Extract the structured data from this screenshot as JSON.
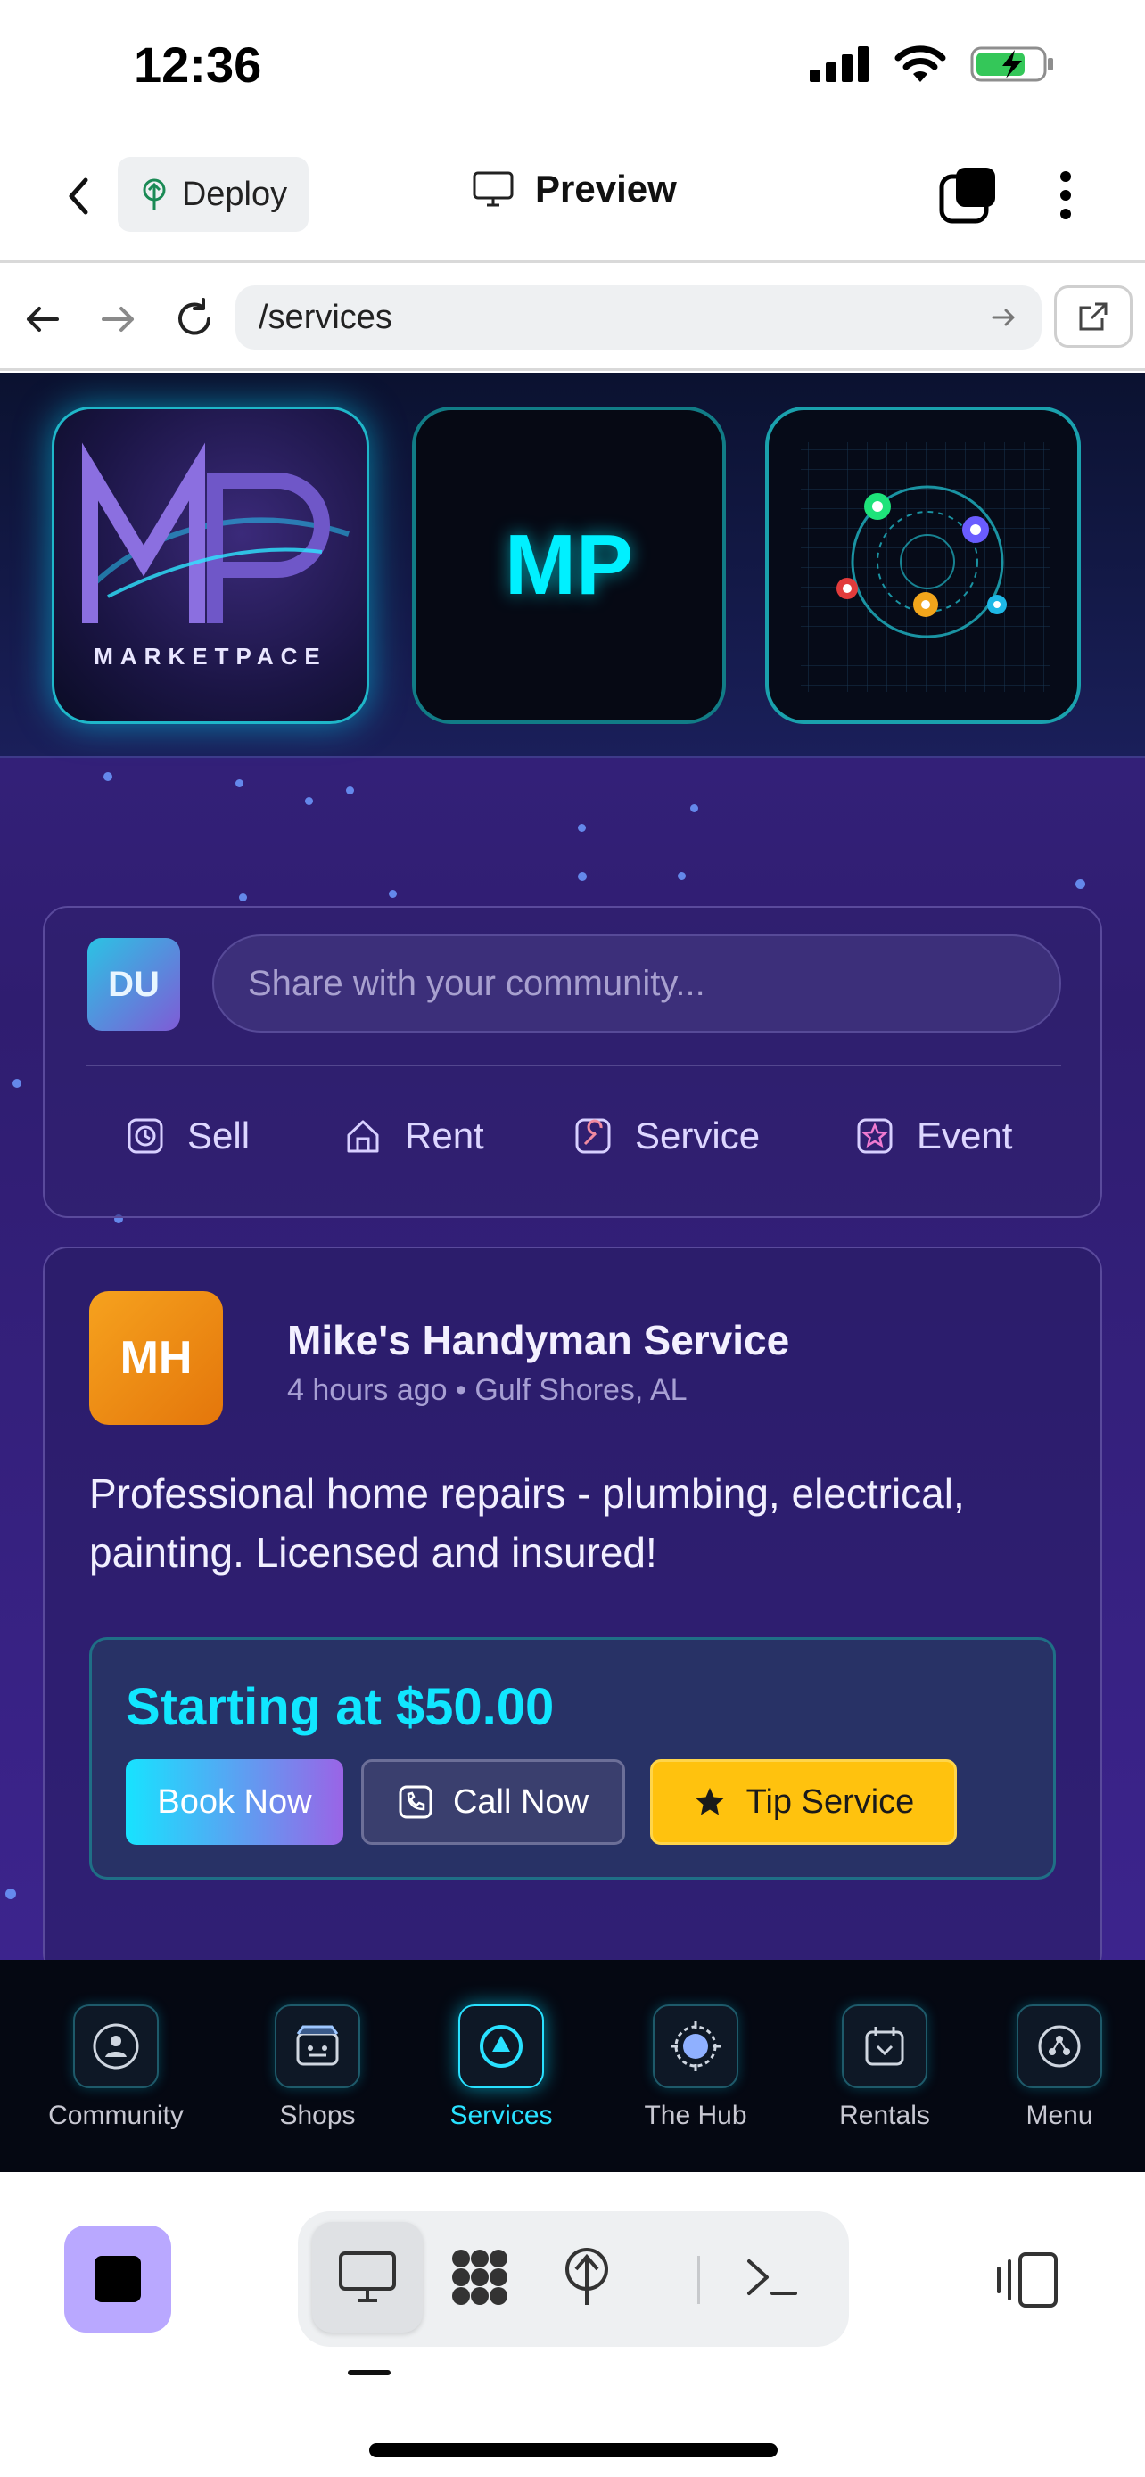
{
  "status_bar": {
    "time": "12:36"
  },
  "toolbar": {
    "deploy_label": "Deploy",
    "preview_label": "Preview"
  },
  "url_bar": {
    "url": "/services"
  },
  "logos": {
    "tile1_text": "MARKETPACE",
    "tile2_text": "MP"
  },
  "composer": {
    "avatar_initials": "DU",
    "placeholder": "Share with your community...",
    "actions": [
      {
        "label": "Sell",
        "icon": "clock-icon"
      },
      {
        "label": "Rent",
        "icon": "house-icon"
      },
      {
        "label": "Service",
        "icon": "wrench-icon"
      },
      {
        "label": "Event",
        "icon": "star-icon"
      }
    ]
  },
  "post": {
    "avatar_initials": "MH",
    "name": "Mike's Handyman Service",
    "time": "4 hours ago",
    "location": "Gulf Shores, AL",
    "body": "Professional home repairs - plumbing, electrical, painting. Licensed and insured!",
    "price": "Starting at $50.00",
    "buttons": {
      "book": "Book Now",
      "call": "Call Now",
      "tip": "Tip Service"
    }
  },
  "app_nav": [
    {
      "label": "Community",
      "icon": "community-icon",
      "active": false
    },
    {
      "label": "Shops",
      "icon": "shop-icon",
      "active": false
    },
    {
      "label": "Services",
      "icon": "services-icon",
      "active": true
    },
    {
      "label": "The Hub",
      "icon": "hub-icon",
      "active": false
    },
    {
      "label": "Rentals",
      "icon": "rentals-icon",
      "active": false
    },
    {
      "label": "Menu",
      "icon": "menu-icon",
      "active": false
    }
  ],
  "colors": {
    "accent": "#29e1ff",
    "tip_yellow": "#ffc20e",
    "stop_purple": "#b9a8ff",
    "page_purple": "#3a2585"
  }
}
